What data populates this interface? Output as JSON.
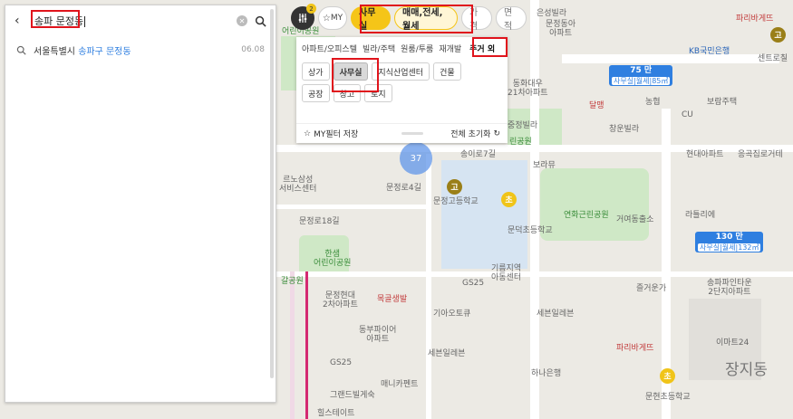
{
  "search": {
    "query": "송파 문정동",
    "result": {
      "prefix": "서울특별시 ",
      "district": "송파구",
      "space": " ",
      "dong": "문정동",
      "date": "06.08"
    }
  },
  "filter_bar": {
    "badge": "2",
    "my_label": "MY",
    "office_label": "사무실",
    "deal_label": "매매,전세,월세",
    "price_label": "가격",
    "area_label": "면적"
  },
  "filter_panel": {
    "categories": [
      "아파트/오피스텔",
      "빌라/주택",
      "원룸/투룸",
      "재개발",
      "주거 외"
    ],
    "subtypes": [
      "상가",
      "사무실",
      "지식산업센터",
      "건물",
      "공장",
      "창고",
      "토지"
    ],
    "save_label": "MY필터 저장",
    "reset_label": "전체 초기화"
  },
  "map": {
    "cluster_count": "37",
    "price_tags": [
      {
        "price": "75 만",
        "sub": "사무실|월세|85㎡"
      },
      {
        "price": "130 만",
        "sub": "사무실|월세|132㎡"
      }
    ],
    "labels": {
      "l1": "어린이공원",
      "l2": "파리바게뜨",
      "l3": "은성빌라",
      "l4": "문정동아\n아파트",
      "l5": "KB국민은행",
      "l6": "센트로칠",
      "l7": "농협",
      "l8": "CU",
      "l9": "보람주택",
      "l10": "창운빌라",
      "l11": "현대아파트",
      "l12": "응곡집로거테",
      "l13": "르노삼성\n서비스센터",
      "l14": "문정로4길",
      "l15": "송이로7길",
      "l16": "문정고등학교",
      "l17": "보라뮤",
      "l18": "연화근린공원",
      "l19": "문덕초등학교",
      "l20": "거여동출소",
      "l21": "라틀리에",
      "l22": "문정로18길",
      "l23": "한샘\n어린이공원",
      "l24": "기름지역\n아동센터",
      "l25": "GS25",
      "l26": "즐거운가",
      "l27": "송파파인타운\n2단지아파트",
      "l28": "문정현대\n2차아파트",
      "l29": "목골생발",
      "l30": "기아오토큐",
      "l31": "세븐일레븐",
      "l32": "동부파이어\n아파트",
      "l33": "파리바게뜨",
      "l34": "이마트24",
      "l35": "하나은행",
      "l36": "세븐일레븐",
      "l37": "GS25",
      "l38": "매니카펜트",
      "l39": "그랜드빌게숙",
      "l40": "문현초등학교",
      "l41": "힐스테이트",
      "l42": "장지동",
      "l43": "동화대우\n21차아파트",
      "l44": "달맹",
      "l45": "린공원",
      "l46": "중정빌라",
      "l47": "갈공원"
    },
    "pins": {
      "olive1": "고",
      "olive2": "고",
      "yellow1": "초",
      "yellow2": "초"
    }
  }
}
